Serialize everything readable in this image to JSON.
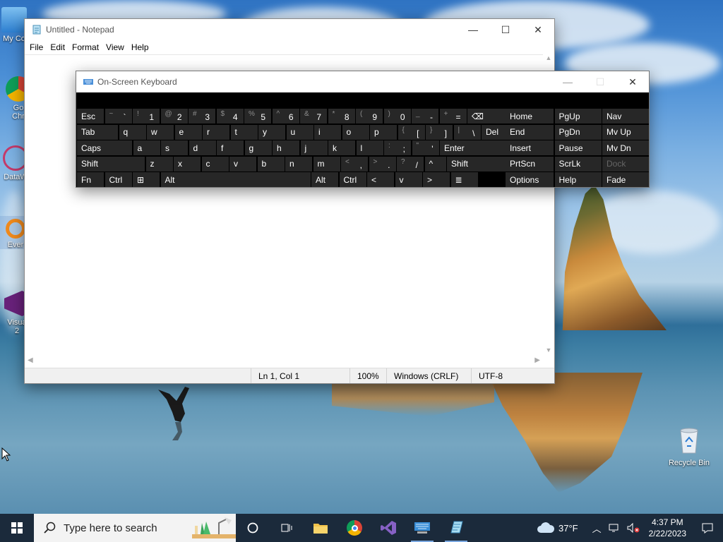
{
  "desktop": {
    "icons_left": [
      {
        "label": "My Co",
        "name": "my-computer"
      },
      {
        "label": "Go",
        "label2": "Chr",
        "name": "google-chrome"
      },
      {
        "label": "DataW",
        "name": "datawrapper"
      },
      {
        "label": "Ever",
        "name": "everything"
      },
      {
        "label": "Visua",
        "label2": "2",
        "name": "visual-studio"
      }
    ],
    "recycle_bin": "Recycle Bin"
  },
  "notepad": {
    "title": "Untitled - Notepad",
    "menu": [
      "File",
      "Edit",
      "Format",
      "View",
      "Help"
    ],
    "status": {
      "position": "Ln 1, Col 1",
      "zoom": "100%",
      "line_ending": "Windows (CRLF)",
      "encoding": "UTF-8"
    }
  },
  "osk": {
    "title": "On-Screen Keyboard",
    "rows": [
      [
        {
          "m": "Esc",
          "w": 38
        },
        {
          "s": "~",
          "m": "`",
          "w": 38
        },
        {
          "s": "!",
          "m": "1",
          "w": 38
        },
        {
          "s": "@",
          "m": "2",
          "w": 38
        },
        {
          "s": "#",
          "m": "3",
          "w": 38
        },
        {
          "s": "$",
          "m": "4",
          "w": 38
        },
        {
          "s": "%",
          "m": "5",
          "w": 38
        },
        {
          "s": "^",
          "m": "6",
          "w": 38
        },
        {
          "s": "&",
          "m": "7",
          "w": 38
        },
        {
          "s": "*",
          "m": "8",
          "w": 38
        },
        {
          "s": "(",
          "m": "9",
          "w": 38
        },
        {
          "s": ")",
          "m": "0",
          "w": 38
        },
        {
          "s": "_",
          "m": "-",
          "w": 38
        },
        {
          "s": "+",
          "m": "=",
          "w": 38
        },
        {
          "m": "⌫",
          "w": 68
        }
      ],
      [
        {
          "m": "Tab",
          "w": 58
        },
        {
          "m": "q",
          "w": 38
        },
        {
          "m": "w",
          "w": 38
        },
        {
          "m": "e",
          "w": 38
        },
        {
          "m": "r",
          "w": 38
        },
        {
          "m": "t",
          "w": 38
        },
        {
          "m": "y",
          "w": 38
        },
        {
          "m": "u",
          "w": 38
        },
        {
          "m": "i",
          "w": 38
        },
        {
          "m": "o",
          "w": 38
        },
        {
          "m": "p",
          "w": 38
        },
        {
          "s": "{",
          "m": "[",
          "w": 38
        },
        {
          "s": "}",
          "m": "]",
          "w": 38
        },
        {
          "s": "|",
          "m": "\\",
          "w": 38
        },
        {
          "m": "Del",
          "w": 48
        }
      ],
      [
        {
          "m": "Caps",
          "w": 78
        },
        {
          "m": "a",
          "w": 38
        },
        {
          "m": "s",
          "w": 38
        },
        {
          "m": "d",
          "w": 38
        },
        {
          "m": "f",
          "w": 38
        },
        {
          "m": "g",
          "w": 38
        },
        {
          "m": "h",
          "w": 38
        },
        {
          "m": "j",
          "w": 38
        },
        {
          "m": "k",
          "w": 38
        },
        {
          "m": "l",
          "w": 38
        },
        {
          "s": ":",
          "m": ";",
          "w": 38
        },
        {
          "s": "\"",
          "m": "'",
          "w": 38
        },
        {
          "m": "Enter",
          "w": 106
        }
      ],
      [
        {
          "m": "Shift",
          "w": 96
        },
        {
          "m": "z",
          "w": 38
        },
        {
          "m": "x",
          "w": 38
        },
        {
          "m": "c",
          "w": 38
        },
        {
          "m": "v",
          "w": 38
        },
        {
          "m": "b",
          "w": 38
        },
        {
          "m": "n",
          "w": 38
        },
        {
          "m": "m",
          "w": 38
        },
        {
          "s": "<",
          "m": ",",
          "w": 38
        },
        {
          "s": ">",
          "m": ".",
          "w": 38
        },
        {
          "s": "?",
          "m": "/",
          "w": 38
        },
        {
          "m": "^",
          "w": 30
        },
        {
          "m": "Shift",
          "w": 86
        }
      ],
      [
        {
          "m": "Fn",
          "w": 38
        },
        {
          "m": "Ctrl",
          "w": 38
        },
        {
          "m": "⊞",
          "w": 38
        },
        {
          "m": "Alt",
          "w": 212
        },
        {
          "m": "Alt",
          "w": 38
        },
        {
          "m": "Ctrl",
          "w": 38
        },
        {
          "m": "<",
          "w": 38
        },
        {
          "m": "v",
          "w": 38
        },
        {
          "m": ">",
          "w": 38
        },
        {
          "m": "≣",
          "w": 38
        }
      ]
    ],
    "side_keys": [
      [
        "Home",
        "PgUp",
        "Nav"
      ],
      [
        "End",
        "PgDn",
        "Mv Up"
      ],
      [
        "Insert",
        "Pause",
        "Mv Dn"
      ],
      [
        "PrtScn",
        "ScrLk",
        "Dock"
      ],
      [
        "Options",
        "Help",
        "Fade"
      ]
    ]
  },
  "taskbar": {
    "search_placeholder": "Type here to search",
    "weather": "37°F",
    "time": "4:37 PM",
    "date": "2/22/2023"
  },
  "colors": {
    "taskbar": "#1b2a3b",
    "osk_key": "#272727",
    "osk_background": "#000000"
  }
}
